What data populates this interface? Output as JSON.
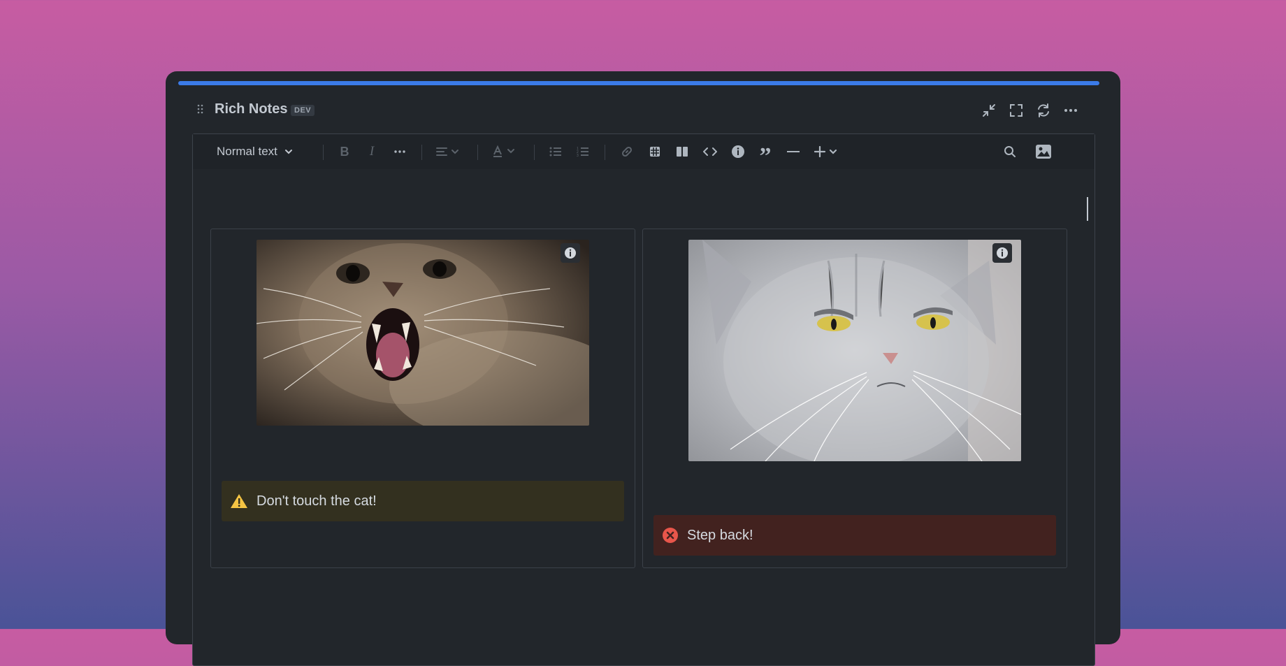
{
  "app": {
    "title": "Rich Notes",
    "badge": "DEV"
  },
  "header_controls": [
    {
      "icon": "collapse-icon"
    },
    {
      "icon": "fullscreen-icon"
    },
    {
      "icon": "refresh-icon"
    },
    {
      "icon": "more-icon"
    }
  ],
  "toolbar": {
    "text_style": "Normal text",
    "buttons": [
      "bold-icon",
      "italic-icon",
      "more-formatting-icon",
      "alignment-icon",
      "text-color-icon",
      "bullet-list-icon",
      "numbered-list-icon",
      "link-icon",
      "table-icon",
      "layout-icon",
      "code-icon",
      "info-panel-icon",
      "quote-icon",
      "divider-icon",
      "insert-icon",
      "search-icon",
      "image-icon"
    ]
  },
  "panels": [
    {
      "image": {
        "description_icon": "info-icon",
        "subject": "angry-tabby-cat"
      },
      "note": {
        "type": "warning",
        "icon": "warning-icon",
        "text": "Don't touch the cat!",
        "bg": "#33301f",
        "icon_color": "#f5c443"
      }
    },
    {
      "image": {
        "description_icon": "info-icon",
        "subject": "grumpy-grey-cat"
      },
      "note": {
        "type": "error",
        "icon": "error-icon",
        "text": "Step back!",
        "bg": "#42221f",
        "icon_color": "#e8564b"
      }
    }
  ],
  "colors": {
    "accent": "#3b7be8",
    "surface": "#22262b",
    "toolbar": "#1f2328",
    "text": "#c3c9d1",
    "muted_icon": "#5c636b"
  }
}
